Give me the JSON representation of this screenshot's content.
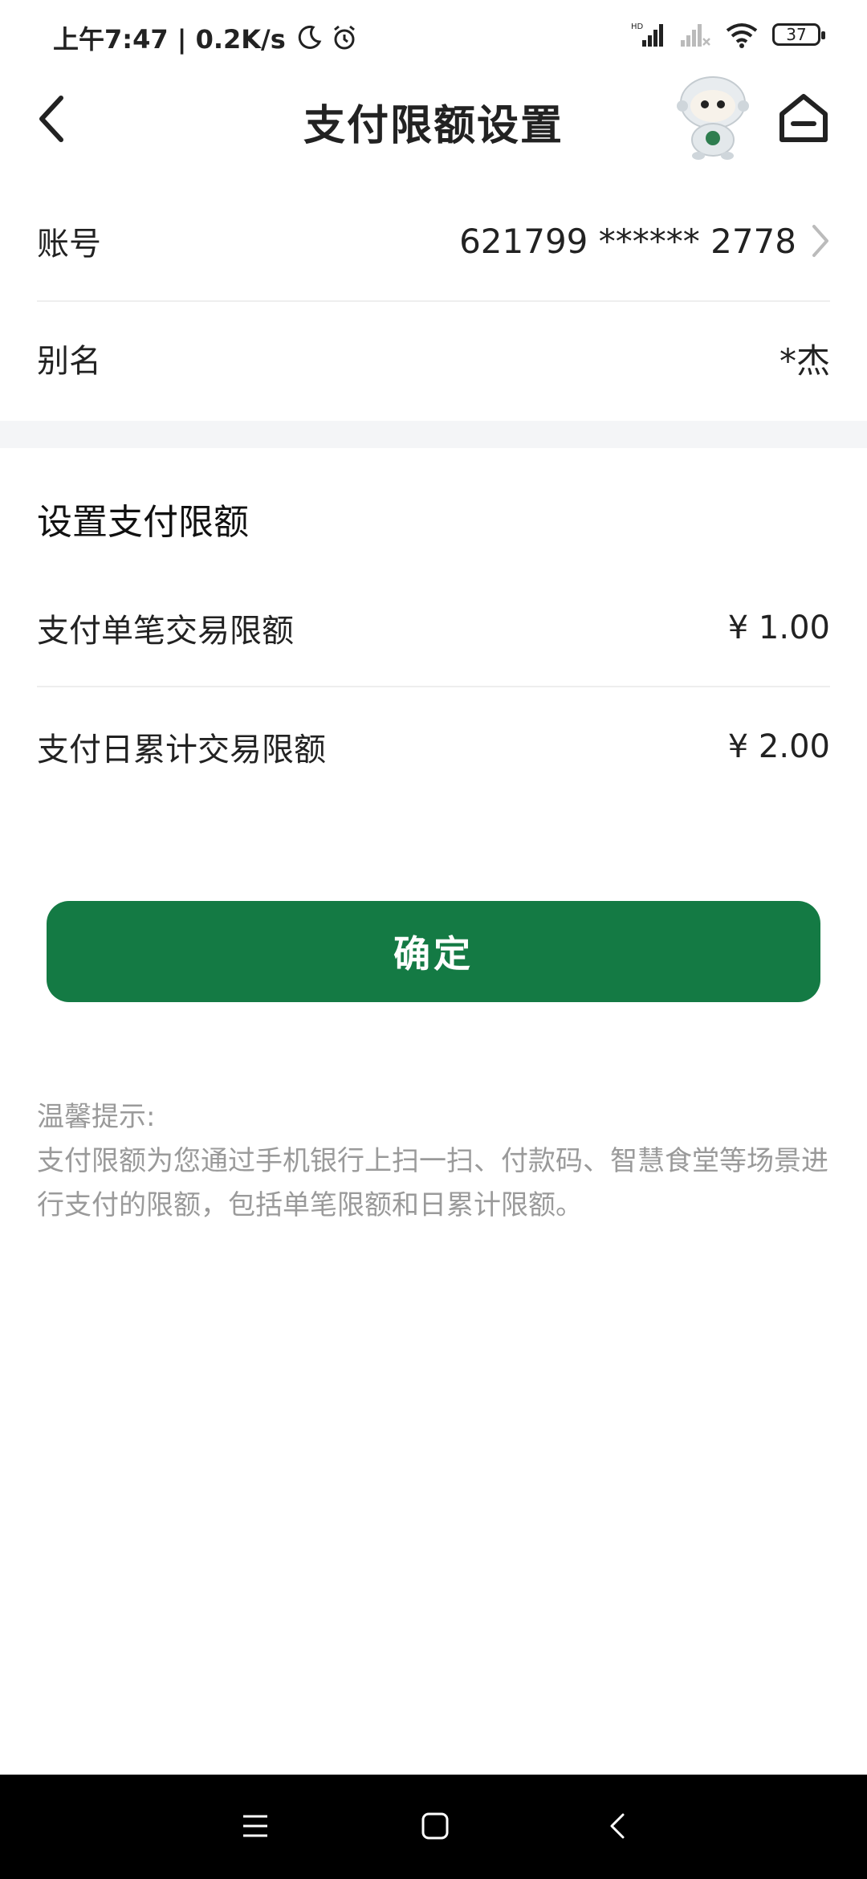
{
  "status_bar": {
    "time_speed": "上午7:47 | 0.2K/s",
    "signal_label": "HD",
    "battery": "37"
  },
  "header": {
    "title": "支付限额设置"
  },
  "account": {
    "label": "账号",
    "value": "621799 ****** 2778"
  },
  "alias": {
    "label": "别名",
    "value": "*杰"
  },
  "limits": {
    "section_title": "设置支付限额",
    "single": {
      "label": "支付单笔交易限额",
      "value": "¥ 1.00"
    },
    "daily": {
      "label": "支付日累计交易限额",
      "value": "¥ 2.00"
    }
  },
  "confirm_button": "确定",
  "tip": {
    "title": "温馨提示:",
    "body": "支付限额为您通过手机银行上扫一扫、付款码、智慧食堂等场景进行支付的限额，包括单笔限额和日累计限额。"
  },
  "colors": {
    "primary_green": "#147a44"
  }
}
